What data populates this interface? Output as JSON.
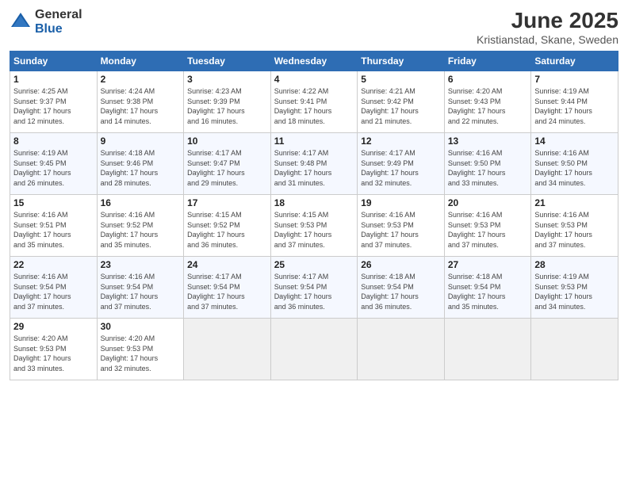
{
  "header": {
    "logo_general": "General",
    "logo_blue": "Blue",
    "month_title": "June 2025",
    "location": "Kristianstad, Skane, Sweden"
  },
  "weekdays": [
    "Sunday",
    "Monday",
    "Tuesday",
    "Wednesday",
    "Thursday",
    "Friday",
    "Saturday"
  ],
  "weeks": [
    [
      {
        "day": "1",
        "detail": "Sunrise: 4:25 AM\nSunset: 9:37 PM\nDaylight: 17 hours\nand 12 minutes."
      },
      {
        "day": "2",
        "detail": "Sunrise: 4:24 AM\nSunset: 9:38 PM\nDaylight: 17 hours\nand 14 minutes."
      },
      {
        "day": "3",
        "detail": "Sunrise: 4:23 AM\nSunset: 9:39 PM\nDaylight: 17 hours\nand 16 minutes."
      },
      {
        "day": "4",
        "detail": "Sunrise: 4:22 AM\nSunset: 9:41 PM\nDaylight: 17 hours\nand 18 minutes."
      },
      {
        "day": "5",
        "detail": "Sunrise: 4:21 AM\nSunset: 9:42 PM\nDaylight: 17 hours\nand 21 minutes."
      },
      {
        "day": "6",
        "detail": "Sunrise: 4:20 AM\nSunset: 9:43 PM\nDaylight: 17 hours\nand 22 minutes."
      },
      {
        "day": "7",
        "detail": "Sunrise: 4:19 AM\nSunset: 9:44 PM\nDaylight: 17 hours\nand 24 minutes."
      }
    ],
    [
      {
        "day": "8",
        "detail": "Sunrise: 4:19 AM\nSunset: 9:45 PM\nDaylight: 17 hours\nand 26 minutes."
      },
      {
        "day": "9",
        "detail": "Sunrise: 4:18 AM\nSunset: 9:46 PM\nDaylight: 17 hours\nand 28 minutes."
      },
      {
        "day": "10",
        "detail": "Sunrise: 4:17 AM\nSunset: 9:47 PM\nDaylight: 17 hours\nand 29 minutes."
      },
      {
        "day": "11",
        "detail": "Sunrise: 4:17 AM\nSunset: 9:48 PM\nDaylight: 17 hours\nand 31 minutes."
      },
      {
        "day": "12",
        "detail": "Sunrise: 4:17 AM\nSunset: 9:49 PM\nDaylight: 17 hours\nand 32 minutes."
      },
      {
        "day": "13",
        "detail": "Sunrise: 4:16 AM\nSunset: 9:50 PM\nDaylight: 17 hours\nand 33 minutes."
      },
      {
        "day": "14",
        "detail": "Sunrise: 4:16 AM\nSunset: 9:50 PM\nDaylight: 17 hours\nand 34 minutes."
      }
    ],
    [
      {
        "day": "15",
        "detail": "Sunrise: 4:16 AM\nSunset: 9:51 PM\nDaylight: 17 hours\nand 35 minutes."
      },
      {
        "day": "16",
        "detail": "Sunrise: 4:16 AM\nSunset: 9:52 PM\nDaylight: 17 hours\nand 35 minutes."
      },
      {
        "day": "17",
        "detail": "Sunrise: 4:15 AM\nSunset: 9:52 PM\nDaylight: 17 hours\nand 36 minutes."
      },
      {
        "day": "18",
        "detail": "Sunrise: 4:15 AM\nSunset: 9:53 PM\nDaylight: 17 hours\nand 37 minutes."
      },
      {
        "day": "19",
        "detail": "Sunrise: 4:16 AM\nSunset: 9:53 PM\nDaylight: 17 hours\nand 37 minutes."
      },
      {
        "day": "20",
        "detail": "Sunrise: 4:16 AM\nSunset: 9:53 PM\nDaylight: 17 hours\nand 37 minutes."
      },
      {
        "day": "21",
        "detail": "Sunrise: 4:16 AM\nSunset: 9:53 PM\nDaylight: 17 hours\nand 37 minutes."
      }
    ],
    [
      {
        "day": "22",
        "detail": "Sunrise: 4:16 AM\nSunset: 9:54 PM\nDaylight: 17 hours\nand 37 minutes."
      },
      {
        "day": "23",
        "detail": "Sunrise: 4:16 AM\nSunset: 9:54 PM\nDaylight: 17 hours\nand 37 minutes."
      },
      {
        "day": "24",
        "detail": "Sunrise: 4:17 AM\nSunset: 9:54 PM\nDaylight: 17 hours\nand 37 minutes."
      },
      {
        "day": "25",
        "detail": "Sunrise: 4:17 AM\nSunset: 9:54 PM\nDaylight: 17 hours\nand 36 minutes."
      },
      {
        "day": "26",
        "detail": "Sunrise: 4:18 AM\nSunset: 9:54 PM\nDaylight: 17 hours\nand 36 minutes."
      },
      {
        "day": "27",
        "detail": "Sunrise: 4:18 AM\nSunset: 9:54 PM\nDaylight: 17 hours\nand 35 minutes."
      },
      {
        "day": "28",
        "detail": "Sunrise: 4:19 AM\nSunset: 9:53 PM\nDaylight: 17 hours\nand 34 minutes."
      }
    ],
    [
      {
        "day": "29",
        "detail": "Sunrise: 4:20 AM\nSunset: 9:53 PM\nDaylight: 17 hours\nand 33 minutes."
      },
      {
        "day": "30",
        "detail": "Sunrise: 4:20 AM\nSunset: 9:53 PM\nDaylight: 17 hours\nand 32 minutes."
      },
      {
        "day": "",
        "detail": ""
      },
      {
        "day": "",
        "detail": ""
      },
      {
        "day": "",
        "detail": ""
      },
      {
        "day": "",
        "detail": ""
      },
      {
        "day": "",
        "detail": ""
      }
    ]
  ]
}
